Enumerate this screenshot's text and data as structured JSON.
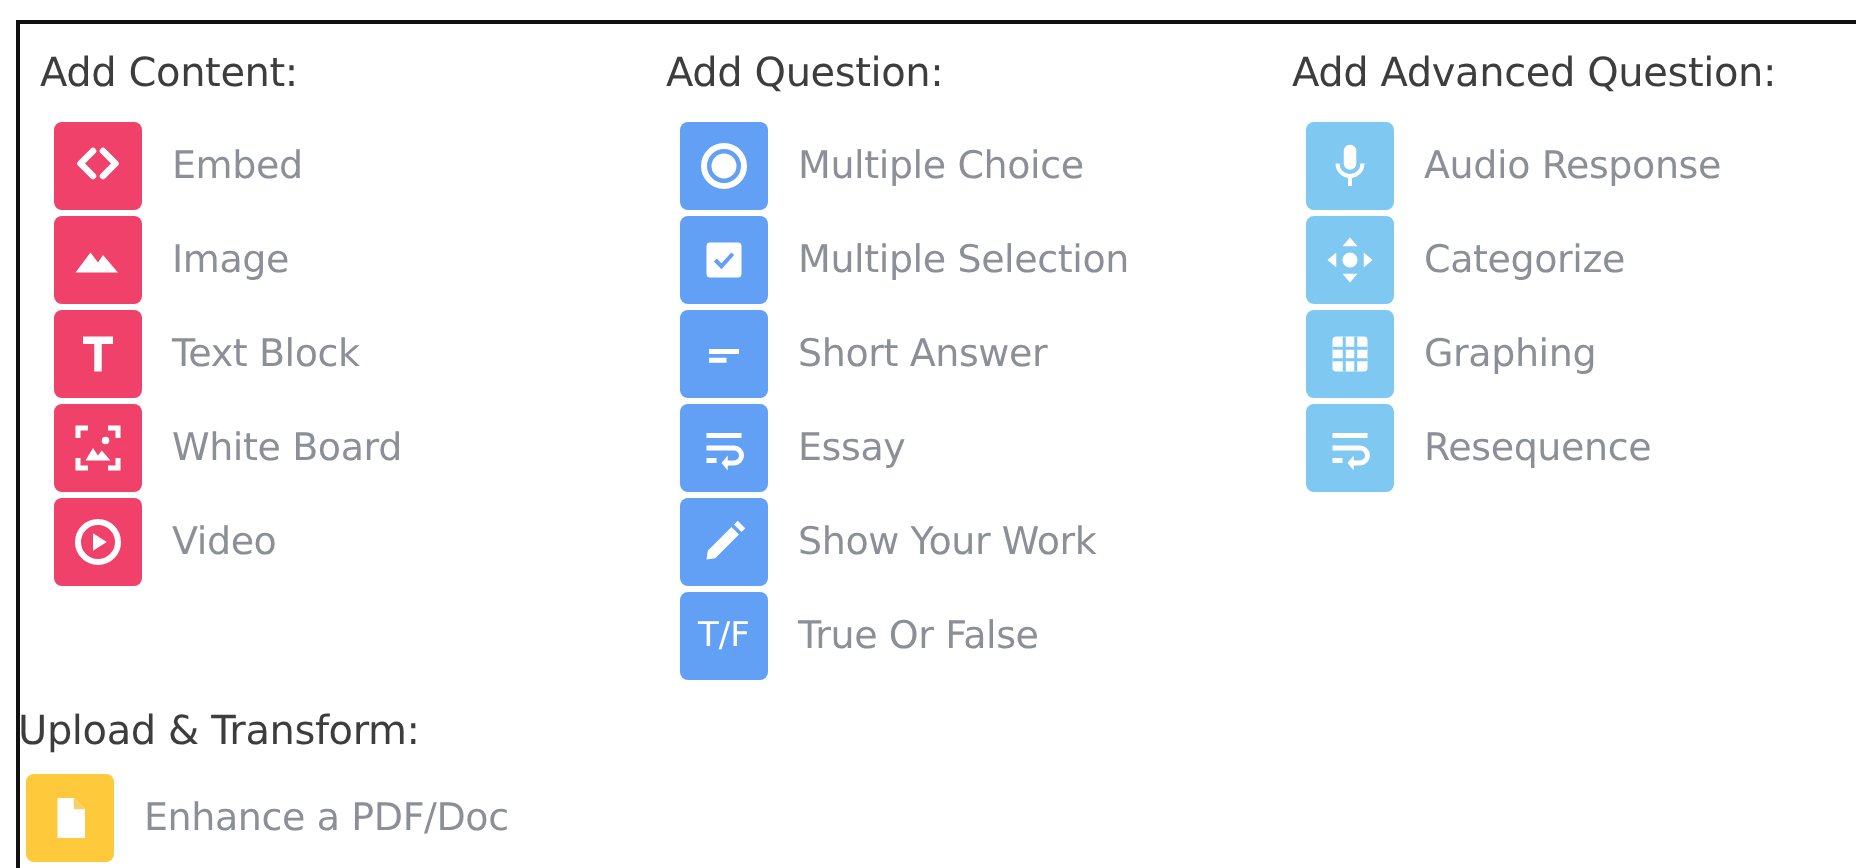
{
  "sections": [
    {
      "heading": "Add Content:",
      "color": "#f0416a",
      "items": [
        {
          "label": "Embed",
          "kind": "code"
        },
        {
          "label": "Image",
          "kind": "mountain"
        },
        {
          "label": "Text Block",
          "kind": "letter"
        },
        {
          "label": "White Board",
          "kind": "whiteboard"
        },
        {
          "label": "Video",
          "kind": "play"
        }
      ]
    },
    {
      "heading": "Add Question:",
      "color": "#62a0f6",
      "items": [
        {
          "label": "Multiple Choice",
          "kind": "radio"
        },
        {
          "label": "Multiple Selection",
          "kind": "checkbox"
        },
        {
          "label": "Short Answer",
          "kind": "lines"
        },
        {
          "label": "Essay",
          "kind": "wrap"
        },
        {
          "label": "Show Your Work",
          "kind": "pencil"
        },
        {
          "label": "True Or False",
          "kind": "text",
          "icon_text": "T/F"
        }
      ]
    },
    {
      "heading": "Add Advanced Question:",
      "color": "#7ec8f1",
      "items": [
        {
          "label": "Audio Response",
          "kind": "mic"
        },
        {
          "label": "Categorize",
          "kind": "move"
        },
        {
          "label": "Graphing",
          "kind": "grid"
        },
        {
          "label": "Resequence",
          "kind": "wrap"
        }
      ]
    },
    {
      "heading": "Upload & Transform:",
      "color": "#fec93a",
      "items": [
        {
          "label": "Enhance a PDF/Doc",
          "kind": "file"
        }
      ]
    }
  ]
}
